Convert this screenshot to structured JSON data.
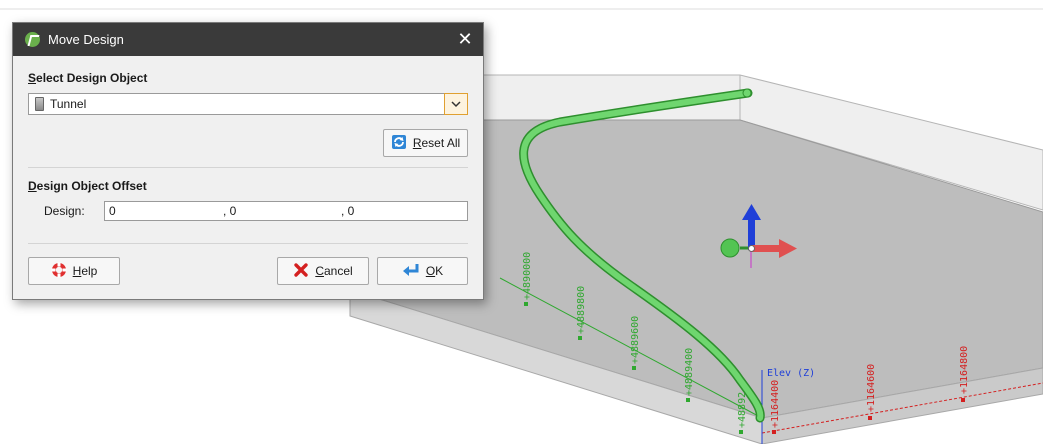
{
  "dialog": {
    "title": "Move Design",
    "close_glyph": "✕",
    "select_section_label": "Select Design Object",
    "selected_object": "Tunnel",
    "reset_all_label": "Reset All",
    "offset_section_label": "Design Object Offset",
    "design_label": "Design:",
    "offset_x": "0",
    "offset_y": ", 0",
    "offset_z": ", 0",
    "help_label": "Help",
    "cancel_label": "Cancel",
    "ok_label": "OK",
    "icons": [
      "app-logo-icon",
      "close-icon",
      "tunnel-object-icon",
      "chevron-down-icon",
      "reset-icon",
      "help-lifebuoy-icon",
      "cancel-x-icon",
      "ok-return-icon"
    ]
  },
  "viewport": {
    "elev_label": "Elev (Z)",
    "northing_labels": [
      "+4890000",
      "+4889800",
      "+4889600",
      "+4889400",
      "+48892"
    ],
    "easting_labels": [
      "+1164400",
      "+1164600",
      "+1164800"
    ],
    "colors": {
      "tunnel": "#5cc85c",
      "northing_axis": "#2fa82f",
      "easting_axis": "#d42020",
      "elev_axis": "#1f3fd8",
      "block_top": "#bdbdbd"
    }
  }
}
